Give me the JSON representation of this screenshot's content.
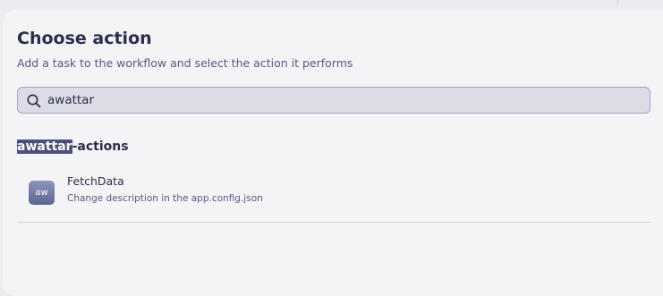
{
  "dialog": {
    "title": "Choose action",
    "subtitle": "Add a task to the workflow and select the action it performs"
  },
  "search": {
    "value": "awattar",
    "icon": "search-icon"
  },
  "group": {
    "highlight": "awattar",
    "suffix": "-actions"
  },
  "actions": [
    {
      "name": "FetchData",
      "description": "Change description in the app.config.json",
      "icon_text": "aw"
    }
  ],
  "colors": {
    "background": "#ebebf0",
    "panel": "#f4f4f7",
    "text_primary": "#2c2e4a",
    "text_secondary": "#55597f",
    "highlight": "#4d4f7d",
    "search_bg": "#dcdce6"
  }
}
